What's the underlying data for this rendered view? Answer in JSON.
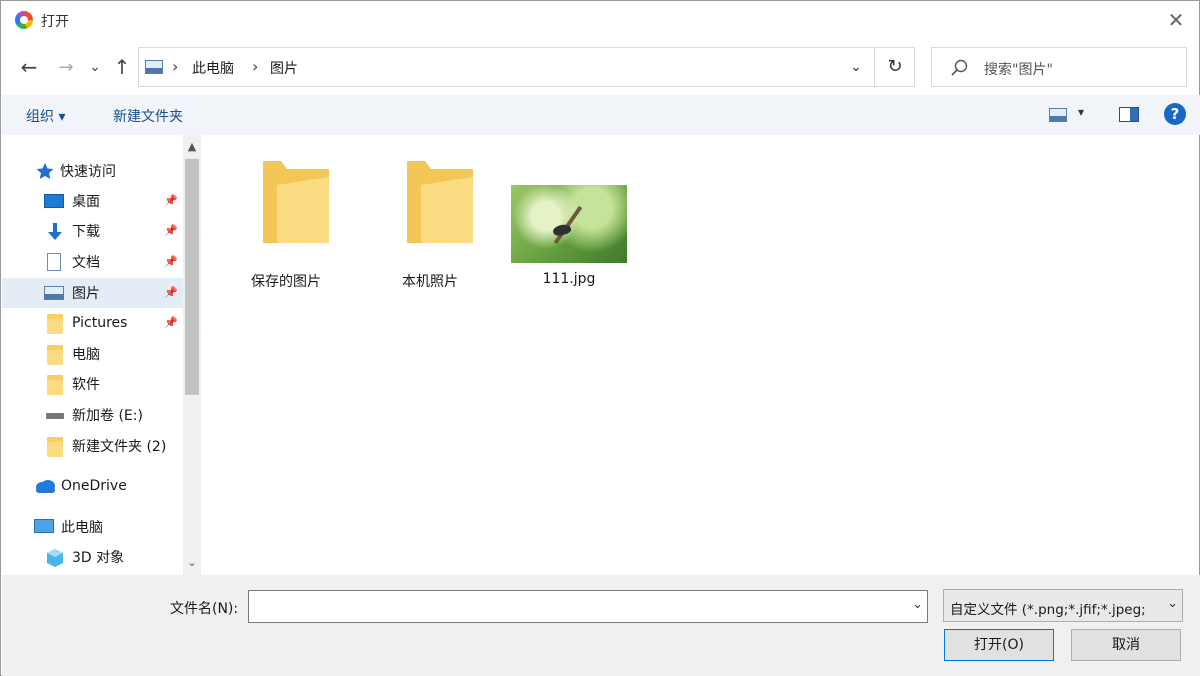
{
  "window": {
    "title": "打开",
    "close_glyph": "✕"
  },
  "nav": {
    "back_glyph": "←",
    "forward_glyph": "→",
    "recent_glyph": "⌄",
    "up_glyph": "↑",
    "address": {
      "segments": [
        "此电脑",
        "图片"
      ],
      "separator": "›",
      "dropdown_glyph": "⌄",
      "refresh_glyph": "↻"
    },
    "search": {
      "placeholder": "搜索\"图片\""
    }
  },
  "commandbar": {
    "organize": "组织 ▾",
    "new_folder": "新建文件夹",
    "view_caret": "▾",
    "help": "?"
  },
  "sidebar": {
    "items": [
      {
        "label": "快速访问",
        "icon": "star-icon"
      },
      {
        "label": "桌面",
        "icon": "desktop-icon",
        "pinned": true
      },
      {
        "label": "下载",
        "icon": "download-icon",
        "pinned": true
      },
      {
        "label": "文档",
        "icon": "document-icon",
        "pinned": true
      },
      {
        "label": "图片",
        "icon": "pictures-icon",
        "pinned": true,
        "selected": true
      },
      {
        "label": "Pictures",
        "icon": "folder-icon",
        "pinned": true
      },
      {
        "label": "电脑",
        "icon": "folder-icon"
      },
      {
        "label": "软件",
        "icon": "folder-icon"
      },
      {
        "label": "新加卷 (E:)",
        "icon": "drive-icon"
      },
      {
        "label": "新建文件夹 (2)",
        "icon": "folder-icon"
      },
      {
        "label": "OneDrive",
        "icon": "cloud-icon"
      },
      {
        "label": "此电脑",
        "icon": "computer-icon"
      },
      {
        "label": "3D 对象",
        "icon": "cube-icon"
      }
    ],
    "pin_glyph": "📌",
    "scroll_up": "▲",
    "scroll_down": "⌄"
  },
  "files": [
    {
      "name": "保存的图片",
      "type": "folder"
    },
    {
      "name": "本机照片",
      "type": "folder"
    },
    {
      "name": "111.jpg",
      "type": "image"
    }
  ],
  "footer": {
    "filename_label": "文件名(N):",
    "filename_value": "",
    "filename_caret": "⌄",
    "filetype": "自定义文件 (*.png;*.jfif;*.jpeg;",
    "filetype_caret": "⌄",
    "open_button": "打开(O)",
    "cancel_button": "取消"
  },
  "colors": {
    "accent": "#0078d7",
    "link": "#1b4e8c",
    "folder": "#fbdc82",
    "selection": "#e4ecf5"
  }
}
